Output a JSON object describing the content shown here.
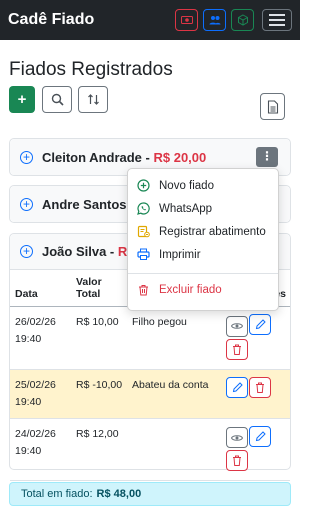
{
  "app": {
    "brand": "Cadê Fiado"
  },
  "page": {
    "title": "Fiados Registrados"
  },
  "toolbar": {
    "add_label": "+"
  },
  "cards": [
    {
      "name": "Cleiton Andrade",
      "separator": " - ",
      "amount": "R$ 20,00",
      "menu_label": "⋮"
    },
    {
      "name": "Andre Santos",
      "separator": " -",
      "amount": ""
    },
    {
      "name": "João Silva",
      "separator": " - ",
      "amount": "R$"
    }
  ],
  "table": {
    "headers": {
      "date": "Data",
      "value": "Valor Total",
      "note": "",
      "actions": "es"
    },
    "rows": [
      {
        "date": "26/02/26 19:40",
        "value": "R$ 10,00",
        "note": "Filho pegou",
        "highlight": false
      },
      {
        "date": "25/02/26 19:40",
        "value": "R$ -10,00",
        "note": "Abateu da conta",
        "highlight": true
      },
      {
        "date": "24/02/26 19:40",
        "value": "R$ 12,00",
        "note": "",
        "highlight": false
      }
    ]
  },
  "total": {
    "label": "Total em fiado:",
    "value": "R$ 48,00"
  },
  "menu": {
    "items": [
      {
        "label": "Novo fiado",
        "icon": "plus-circle-icon"
      },
      {
        "label": "WhatsApp",
        "icon": "whatsapp-icon"
      },
      {
        "label": "Registrar abatimento",
        "icon": "receipt-cut-icon"
      },
      {
        "label": "Imprimir",
        "icon": "printer-icon"
      }
    ],
    "danger_item": {
      "label": "Excluir fiado",
      "icon": "trash-icon"
    }
  },
  "colors": {
    "navbar": "#212529",
    "success": "#198754",
    "primary": "#0d6efd",
    "danger": "#dc3545",
    "warning_row": "#fff3cd",
    "info_bg": "#cff4fc"
  }
}
